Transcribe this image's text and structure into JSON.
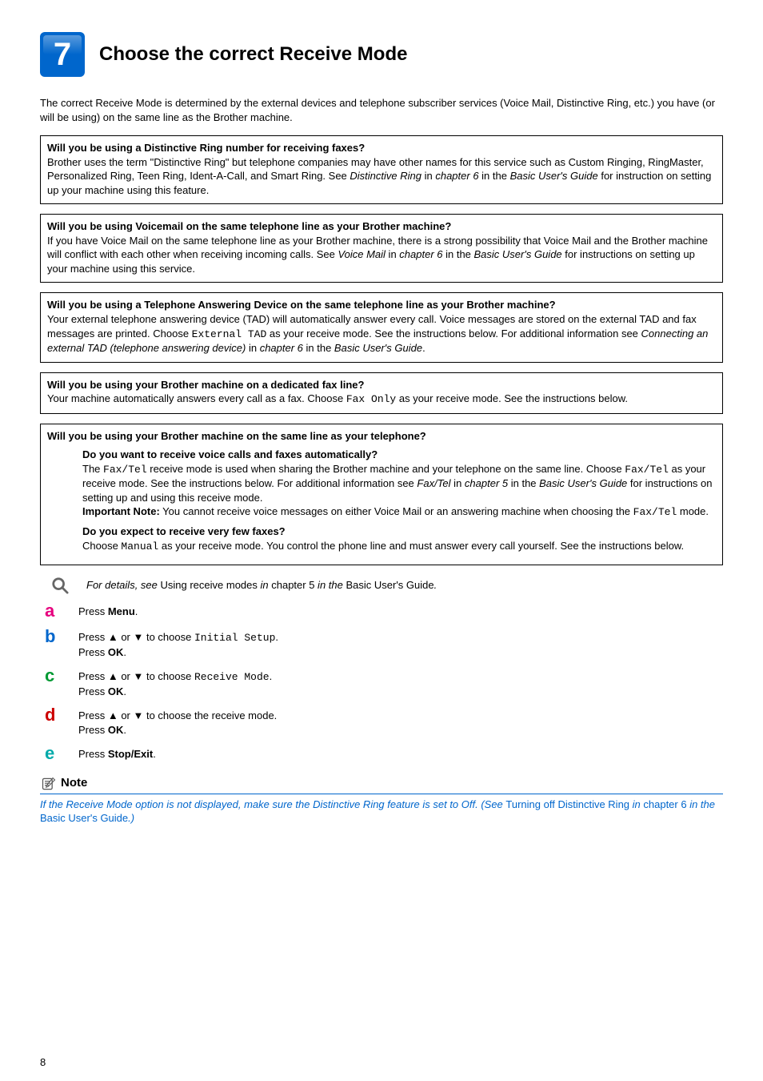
{
  "section": {
    "number": "7",
    "title": "Choose the correct Receive Mode"
  },
  "intro": "The correct Receive Mode is determined by the external devices and telephone subscriber services (Voice Mail, Distinctive Ring, etc.) you have (or will be using) on the same line as the Brother machine.",
  "box1": {
    "heading": "Will you be using a Distinctive Ring number for receiving faxes?",
    "body_pre": "Brother uses the term \"Distinctive Ring\" but telephone companies may have other names for this service such as Custom Ringing, RingMaster, Personalized Ring, Teen Ring, Ident-A-Call, and Smart Ring. See ",
    "body_em1": "Distinctive Ring",
    "body_mid1": " in ",
    "body_em2": "chapter 6",
    "body_mid2": " in the ",
    "body_em3": "Basic User's Guide",
    "body_post": " for instruction on setting up your machine using this feature."
  },
  "box2": {
    "heading": "Will you be using Voicemail on the same telephone line as your Brother machine?",
    "body_pre": "If you have Voice Mail on the same telephone line as your Brother machine, there is a strong possibility that Voice Mail and the Brother machine will conflict with each other when receiving incoming calls. See ",
    "body_em1": "Voice Mail",
    "body_mid1": " in ",
    "body_em2": "chapter 6",
    "body_mid2": " in the ",
    "body_em3": "Basic User's Guide",
    "body_post": " for instructions on setting up your machine using this service."
  },
  "box3": {
    "heading": "Will you be using a Telephone Answering Device on the same telephone line as your Brother machine?",
    "body_pre": "Your external telephone answering device (TAD) will automatically answer every call. Voice messages are stored on the external TAD and fax messages are printed. Choose ",
    "mono1": "External TAD",
    "body_mid1": " as your receive mode. See the instructions below. For additional information see ",
    "body_em1": "Connecting an external TAD (telephone answering device)",
    "body_mid2": " in ",
    "body_em2": "chapter 6",
    "body_mid3": " in the ",
    "body_em3": "Basic User's Guide",
    "body_post": "."
  },
  "box4": {
    "heading": "Will you be using your Brother machine on a dedicated fax line?",
    "body_pre": "Your machine automatically answers every call as a fax. Choose ",
    "mono1": "Fax Only",
    "body_post": " as your receive mode. See the instructions below."
  },
  "box5": {
    "heading": "Will you be using your Brother machine on the same line as your telephone?",
    "sub1": {
      "heading": "Do you want to receive voice calls and faxes automatically?",
      "l1_pre": "The ",
      "l1_mono": "Fax/Tel",
      "l1_post": " receive mode is used when sharing the Brother machine and your telephone on the same line. Choose ",
      "l2_mono": "Fax/Tel",
      "l2_mid1": " as your receive mode. See the instructions below. For additional information see ",
      "l2_em1": "Fax/Tel",
      "l2_mid2": " in ",
      "l2_em2": "chapter 5",
      "l2_mid3": " in the ",
      "l2_em3": "Basic User's Guide",
      "l2_post": " for instructions on setting up and using this receive mode.",
      "imp_label": "Important Note:",
      "imp_pre": " You cannot receive voice messages on either Voice Mail or an answering machine when choosing the ",
      "imp_mono": "Fax/Tel",
      "imp_post": " mode."
    },
    "sub2": {
      "heading": "Do you expect to receive very few faxes?",
      "pre": "Choose ",
      "mono": "Manual",
      "post": " as your receive mode. You control the phone line and must answer every call yourself. See the instructions below."
    }
  },
  "detail": {
    "pre": "For details, see ",
    "roman1": "Using receive modes",
    "mid1": " in ",
    "roman2": "chapter 5",
    "mid2": " in the ",
    "roman3": "Basic User's Guide",
    "post": "."
  },
  "steps": {
    "a": {
      "letter": "a",
      "t1": "Press ",
      "b1": "Menu",
      "t2": "."
    },
    "b": {
      "letter": "b",
      "t1": "Press ▲ or ▼ to choose ",
      "mono": "Initial Setup",
      "t2": ".",
      "t3": "Press ",
      "b2": "OK",
      "t4": "."
    },
    "c": {
      "letter": "c",
      "t1": "Press ▲ or ▼ to choose ",
      "mono": "Receive Mode",
      "t2": ".",
      "t3": "Press ",
      "b2": "OK",
      "t4": "."
    },
    "d": {
      "letter": "d",
      "t1": "Press ▲ or ▼ to choose the receive mode.",
      "t3": "Press ",
      "b2": "OK",
      "t4": "."
    },
    "e": {
      "letter": "e",
      "t1": "Press ",
      "b1": "Stop/Exit",
      "t2": "."
    }
  },
  "note": {
    "title": "Note",
    "pre": "If the Receive Mode option is not displayed, make sure the Distinctive Ring feature is set to Off. (See ",
    "roman1": "Turning off Distinctive Ring",
    "mid1": " in ",
    "roman2": "chapter 6",
    "mid2": " in the ",
    "roman3": "Basic User's Guide",
    "post": ".)"
  },
  "page_number": "8"
}
